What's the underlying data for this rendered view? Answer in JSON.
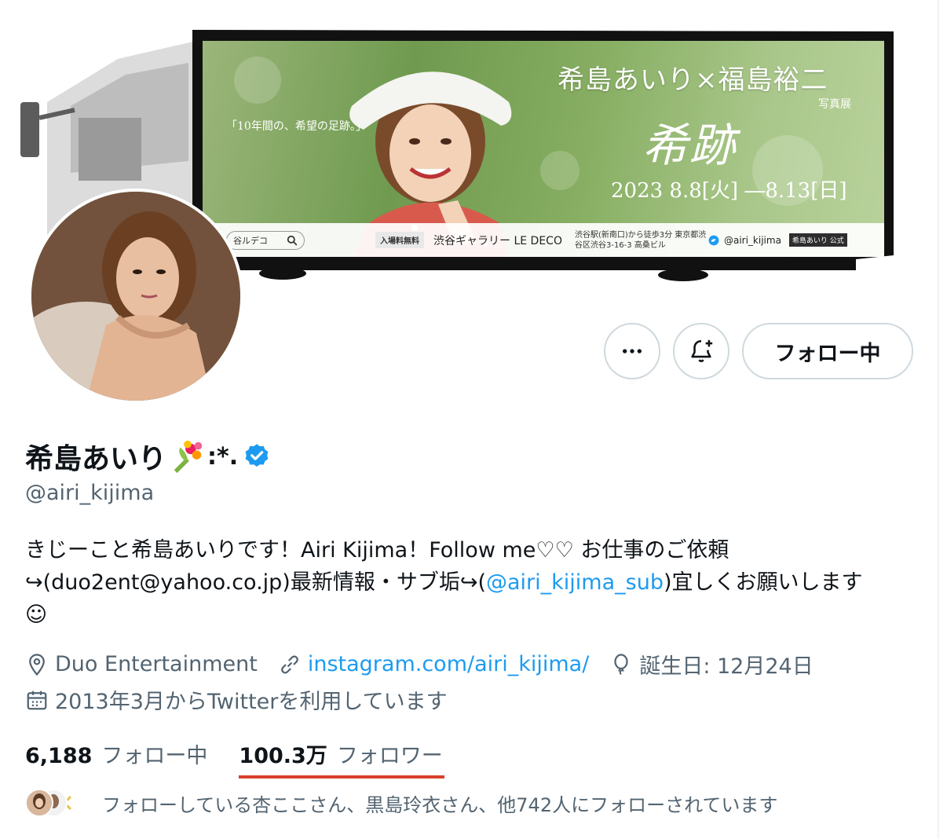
{
  "banner": {
    "title": "希島あいり×福島裕二",
    "subtitle": "写真展",
    "quote": "「10年間の、希望の足跡。」",
    "logo": "希跡",
    "dates": "2023 8.8[火] ―8.13[日]",
    "search_text": "谷ルデコ",
    "admission": "入場料無料",
    "gallery": "渋谷ギャラリー LE DECO",
    "access": "渋谷駅(新南口)から徒歩3分 東京都渋谷区渋谷3-16-3 高桑ビル",
    "handle": "@airi_kijima",
    "tag": "希島あいり 公式"
  },
  "actions": {
    "more_icon": "ellipsis-icon",
    "notify_icon": "bell-plus-icon",
    "follow_label": "フォロー中"
  },
  "profile": {
    "display_name": "希島あいり",
    "name_emoji": "bouquet-emoji",
    "name_suffix": ":*.",
    "verified_icon": "verified-badge-icon",
    "handle": "@airi_kijima"
  },
  "bio": {
    "line1": "きじーこと希島あいりです！Airi Kijima！Follow me♡♡ お仕事のご依頼",
    "line2_pre": "↪(duo2ent@yahoo.co.jp)最新情報・サブ垢↪(",
    "line2_link": "@airi_kijima_sub",
    "line2_post": ")宜しくお願いします",
    "line3": "☺"
  },
  "meta": {
    "location": "Duo Entertainment",
    "website": "instagram.com/airi_kijima/",
    "birthday": "誕生日: 12月24日",
    "joined": "2013年3月からTwitterを利用しています"
  },
  "stats": {
    "following_count": "6,188",
    "following_label": "フォロー中",
    "followers_count": "100.3万",
    "followers_label": "フォロワー"
  },
  "followed_by": {
    "text": "フォローしている杏ここさん、黒島玲衣さん、他742人にフォローされています"
  },
  "colors": {
    "accent_blue": "#1d9bf0",
    "muted_text": "#536471",
    "underline_red": "#d9412c"
  }
}
